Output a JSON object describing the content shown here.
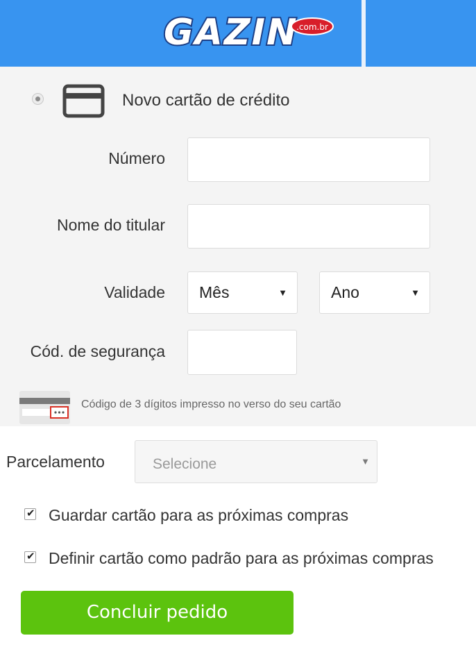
{
  "header": {
    "logo_alt": "Gazin.com.br",
    "logo_wordmark": "GAZIN",
    "logo_domain": ".com.br",
    "bg_color": "#3894f0"
  },
  "card_form": {
    "option_label": "Novo cartão de crédito",
    "option_selected": true,
    "icon": "credit-card-icon",
    "number_label": "Número",
    "number_value": "",
    "holder_label": "Nome do titular",
    "holder_value": "",
    "validity_label": "Validade",
    "month_value": "Mês",
    "year_value": "Ano",
    "cvv_label": "Cód. de segurança",
    "cvv_value": "",
    "cvv_hint": "Código de 3 dígitos impresso no verso do seu cartão",
    "cvv_icon": "card-back-cvv-icon"
  },
  "payment": {
    "installments_label": "Parcelamento",
    "installments_value": "Selecione",
    "save_card_label": "Guardar cartão para as próximas compras",
    "save_card_checked": true,
    "default_card_label": "Definir cartão como padrão para as próximas compras",
    "default_card_checked": true,
    "submit_label": "Concluir pedido",
    "submit_color": "#5cc30e"
  }
}
